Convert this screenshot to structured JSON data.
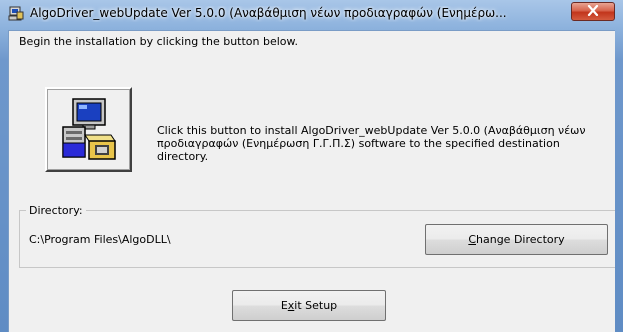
{
  "window": {
    "title": "AlgoDriver_webUpdate Ver 5.0.0 (Αναβάθμιση νέων προδιαγραφών (Ενημέρω...",
    "close_glyph": "✕"
  },
  "main": {
    "intro_text": "Begin the installation by clicking the button below.",
    "install_description": "Click this button to install AlgoDriver_webUpdate Ver 5.0.0 (Αναβάθμιση νέων προδιαγραφών (Ενημέρωση Γ.Γ.Π.Σ) software to the specified destination directory."
  },
  "directory": {
    "label": "Directory:",
    "path": "C:\\Program Files\\AlgoDLL\\",
    "change_button": {
      "accel": "C",
      "rest": "hange Directory"
    }
  },
  "exit_button": {
    "pre": "E",
    "accel": "x",
    "rest": "it Setup"
  },
  "icons": {
    "app_icon": "setup-computer-icon",
    "install_icon": "install-computer-icon"
  }
}
